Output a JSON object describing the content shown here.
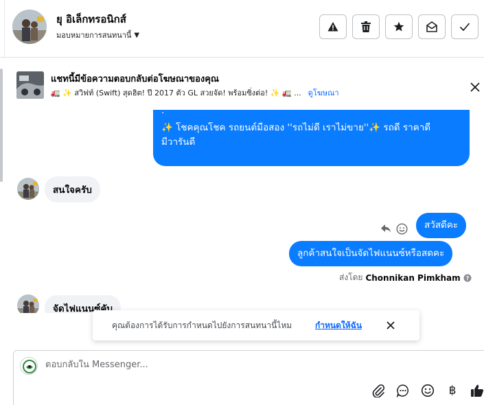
{
  "header": {
    "contact_name": "ยุ อิเล็กทรอนิกส์",
    "assign_label": "มอบหมายการสนทนานี้",
    "buttons": [
      "spam-alert",
      "delete",
      "star",
      "mark-unread",
      "done"
    ]
  },
  "ad_banner": {
    "title": "แชทนี้มีข้อความตอบกลับต่อโฆษณาของคุณ",
    "snippet": "🚛 ✨ สวิฟท์ (Swift) สุดฮิต! ปี 2017 ตัว GL สวยจัด! พร้อมซิ่งต่อ! ✨ 🚛 ...",
    "link_label": "ดูโฆษณา"
  },
  "messages": [
    {
      "direction": "outgoing",
      "lines": [
        "✨ โชคคุณโชค รถยนต์มือสอง ''รถไม่ดี เราไม่ขาย''✨ รถดี ราคาดี",
        "มีวารันตี"
      ]
    },
    {
      "direction": "incoming",
      "text": "สนใจครับ"
    },
    {
      "direction": "outgoing",
      "text": "สวัสดีคะ"
    },
    {
      "direction": "outgoing",
      "text": "ลูกค้าสนใจเป็นจัดไฟแนนซ์หรือสดคะ"
    },
    {
      "direction": "incoming",
      "text": "จัดไฟแนนซ์คับ"
    }
  ],
  "sent_by": {
    "prefix": "ส่งโดย",
    "name": "Chonnikan Pimkham"
  },
  "toast": {
    "text": "คุณต้องการได้รับการกำหนดไปยังการสนทนานี้ไหม",
    "link": "กำหนดให้ฉัน"
  },
  "composer": {
    "placeholder": "ตอบกลับใน Messenger...",
    "icons": [
      "attachment-icon",
      "saved-reply-icon",
      "emoji-icon",
      "payment-icon",
      "like-icon"
    ]
  }
}
